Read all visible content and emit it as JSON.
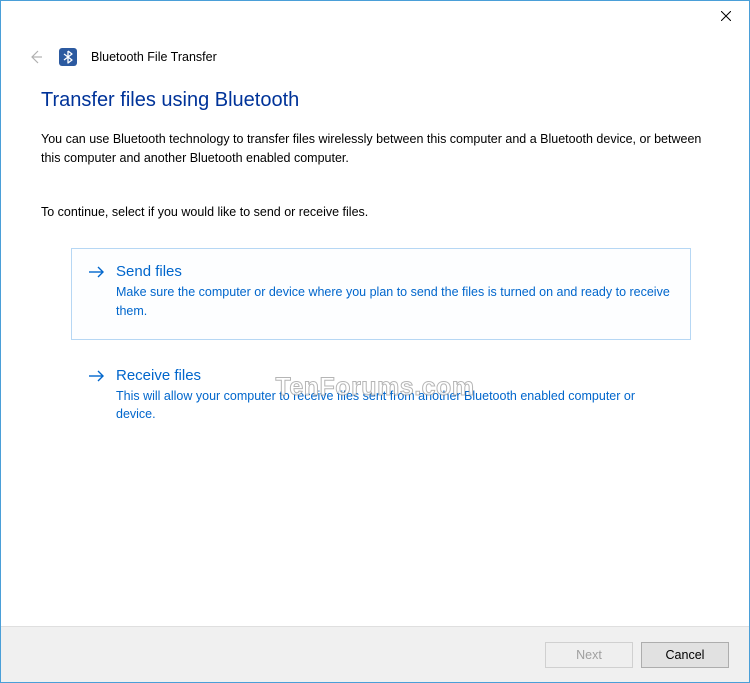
{
  "header": {
    "window_title": "Bluetooth File Transfer"
  },
  "page": {
    "heading": "Transfer files using Bluetooth",
    "description": "You can use Bluetooth technology to transfer files wirelessly between this computer and a Bluetooth device, or between this computer and another Bluetooth enabled computer.",
    "instruction": "To continue, select if you would like to send or receive files."
  },
  "options": {
    "send": {
      "title": "Send files",
      "desc": "Make sure the computer or device where you plan to send the files is turned on and ready to receive them."
    },
    "receive": {
      "title": "Receive files",
      "desc": "This will allow your computer to receive files sent from another Bluetooth enabled computer or device."
    }
  },
  "footer": {
    "next_label": "Next",
    "cancel_label": "Cancel"
  },
  "watermark": "TenForums.com"
}
